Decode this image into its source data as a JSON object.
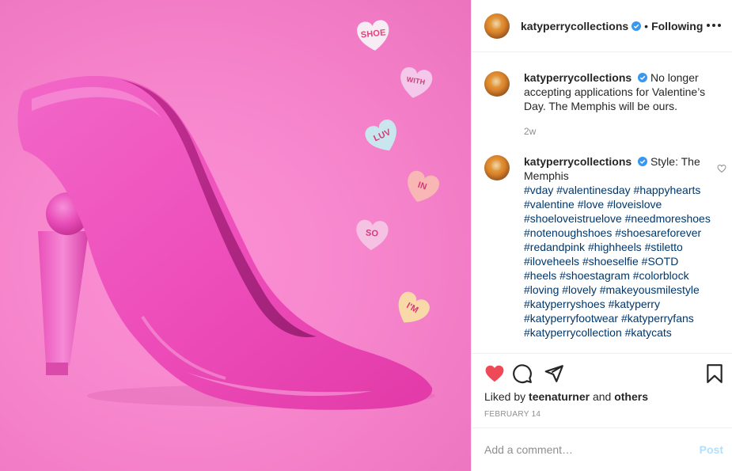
{
  "header": {
    "username": "katyperrycollections",
    "separator": "•",
    "follow_state": "Following"
  },
  "caption": {
    "username": "katyperrycollections",
    "text": "No longer accepting applications for Valentine’s Day. The Memphis will be ours.",
    "time": "2w"
  },
  "comment": {
    "username": "katyperrycollections",
    "text": "Style: The Memphis",
    "hashtags": "#vday #valentinesday #happyhearts #valentine #love #loveislove #shoeloveistruelove #needmoreshoes #notenoughshoes #shoesareforever #redandpink #highheels #stiletto #iloveheels #shoeselfie #SOTD #heels #shoestagram #colorblock #loving #lovely #makeyousmilestyle #katyperryshoes #katyperry #katyperryfootwear #katyperryfans #katyperrycollection #katycats"
  },
  "likes": {
    "prefix": "Liked by",
    "user": "teenaturner",
    "and": "and",
    "others": "others"
  },
  "date": "FEBRUARY 14",
  "add_comment": {
    "placeholder": "Add a comment…",
    "post_label": "Post"
  },
  "image": {
    "candy_hearts": [
      {
        "text": "SHOE",
        "color": "#f7ecf3",
        "text_color": "#e0457b"
      },
      {
        "text": "WITH",
        "color": "#f3c8ea",
        "text_color": "#d63a77"
      },
      {
        "text": "LUV",
        "color": "#c9e6ef",
        "text_color": "#d63a77"
      },
      {
        "text": "IN",
        "color": "#f8b7b5",
        "text_color": "#d63a77"
      },
      {
        "text": "SO",
        "color": "#f6c2e4",
        "text_color": "#d63a77"
      },
      {
        "text": "I'M",
        "color": "#f9d9a8",
        "text_color": "#d63a77"
      }
    ]
  },
  "colors": {
    "like_red": "#ed4956",
    "hashtag_blue": "#00376b",
    "verified_blue": "#3897f0",
    "shoe_pink": "#f04fb8"
  }
}
